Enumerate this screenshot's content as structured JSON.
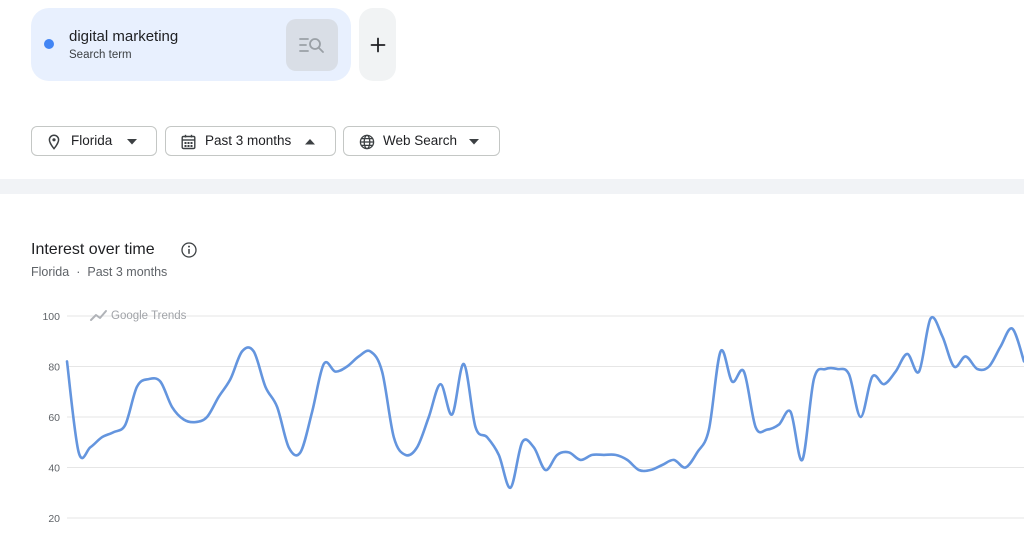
{
  "search_term": {
    "name": "digital marketing",
    "type_label": "Search term",
    "dot_color": "#4285f4",
    "action_icon": "compare-search-icon"
  },
  "add_button": {
    "icon": "plus-icon"
  },
  "filters": {
    "location": {
      "label": "Florida",
      "icon": "location-pin-icon"
    },
    "time_range": {
      "label": "Past 3 months",
      "icon": "calendar-icon"
    },
    "property": {
      "label": "Web Search",
      "icon": "globe-icon"
    }
  },
  "chart": {
    "title": "Interest over time",
    "subtitle_region": "Florida",
    "subtitle_separator": "·",
    "subtitle_period": "Past 3 months",
    "watermark": "Google Trends",
    "line_color": "#6495de"
  },
  "chart_data": {
    "type": "line",
    "title": "Interest over time",
    "xlabel": "",
    "ylabel": "",
    "y_ticks": [
      20,
      40,
      60,
      80,
      100
    ],
    "ylim": [
      15,
      105
    ],
    "grid": true,
    "series": [
      {
        "values": [
          82,
          46,
          48,
          52,
          54,
          57,
          72,
          75,
          74,
          64,
          59,
          58,
          60,
          68,
          75,
          86,
          86,
          72,
          64,
          48,
          46,
          62,
          81,
          78,
          80,
          84,
          86,
          78,
          52,
          45,
          48,
          60,
          73,
          61,
          81,
          56,
          52,
          45,
          32,
          50,
          48,
          39,
          45,
          46,
          43,
          45,
          45,
          45,
          43,
          39,
          39,
          41,
          43,
          40,
          46,
          55,
          86,
          74,
          78,
          56,
          55,
          57,
          62,
          43,
          75,
          79,
          79,
          77,
          60,
          76,
          73,
          78,
          85,
          78,
          99,
          92,
          80,
          84,
          79,
          80,
          88,
          95,
          82
        ]
      }
    ]
  }
}
